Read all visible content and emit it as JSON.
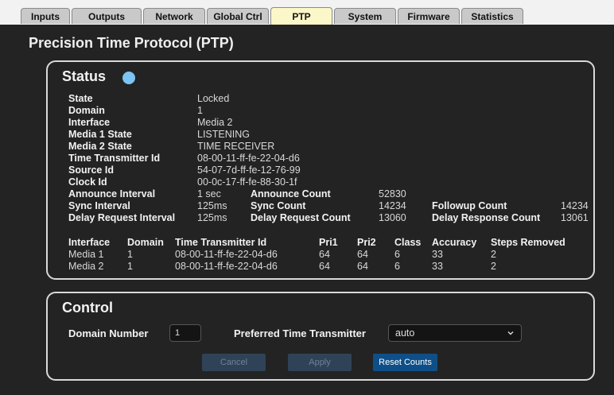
{
  "tabs": [
    {
      "label": "Inputs"
    },
    {
      "label": "Outputs"
    },
    {
      "label": "Network"
    },
    {
      "label": "Global Ctrl"
    },
    {
      "label": "PTP"
    },
    {
      "label": "System"
    },
    {
      "label": "Firmware"
    },
    {
      "label": "Statistics"
    }
  ],
  "active_tab": "PTP",
  "page_title": "Precision Time Protocol (PTP)",
  "status": {
    "title": "Status",
    "indicator_color": "#7cc4f2",
    "fields": [
      {
        "label": "State",
        "value": "Locked"
      },
      {
        "label": "Domain",
        "value": "1"
      },
      {
        "label": "Interface",
        "value": "Media 2"
      },
      {
        "label": "Media 1 State",
        "value": "LISTENING"
      },
      {
        "label": "Media 2 State",
        "value": "TIME RECEIVER"
      },
      {
        "label": "Time Transmitter Id",
        "value": "08-00-11-ff-fe-22-04-d6"
      },
      {
        "label": "Source Id",
        "value": "54-07-7d-ff-fe-12-76-99"
      },
      {
        "label": "Clock Id",
        "value": "00-0c-17-ff-fe-88-30-1f"
      }
    ],
    "intervals": {
      "announce_interval": {
        "label": "Announce Interval",
        "value": "1 sec"
      },
      "announce_count": {
        "label": "Announce Count",
        "value": "52830"
      },
      "sync_interval": {
        "label": "Sync Interval",
        "value": "125ms"
      },
      "sync_count": {
        "label": "Sync Count",
        "value": "14234"
      },
      "followup_count": {
        "label": "Followup Count",
        "value": "14234"
      },
      "delay_request_interval": {
        "label": "Delay Request Interval",
        "value": "125ms"
      },
      "delay_request_count": {
        "label": "Delay Request Count",
        "value": "13060"
      },
      "delay_response_count": {
        "label": "Delay Response Count",
        "value": "13061"
      }
    },
    "table": {
      "headers": [
        "Interface",
        "Domain",
        "Time Transmitter Id",
        "Pri1",
        "Pri2",
        "Class",
        "Accuracy",
        "Steps Removed"
      ],
      "rows": [
        [
          "Media 1",
          "1",
          "08-00-11-ff-fe-22-04-d6",
          "64",
          "64",
          "6",
          "33",
          "2"
        ],
        [
          "Media 2",
          "1",
          "08-00-11-ff-fe-22-04-d6",
          "64",
          "64",
          "6",
          "33",
          "2"
        ]
      ]
    }
  },
  "control": {
    "title": "Control",
    "domain_number_label": "Domain Number",
    "domain_number_value": "1",
    "preferred_tt_label": "Preferred Time Transmitter",
    "preferred_tt_value": "auto",
    "buttons": {
      "cancel": "Cancel",
      "apply": "Apply",
      "reset": "Reset Counts"
    }
  }
}
